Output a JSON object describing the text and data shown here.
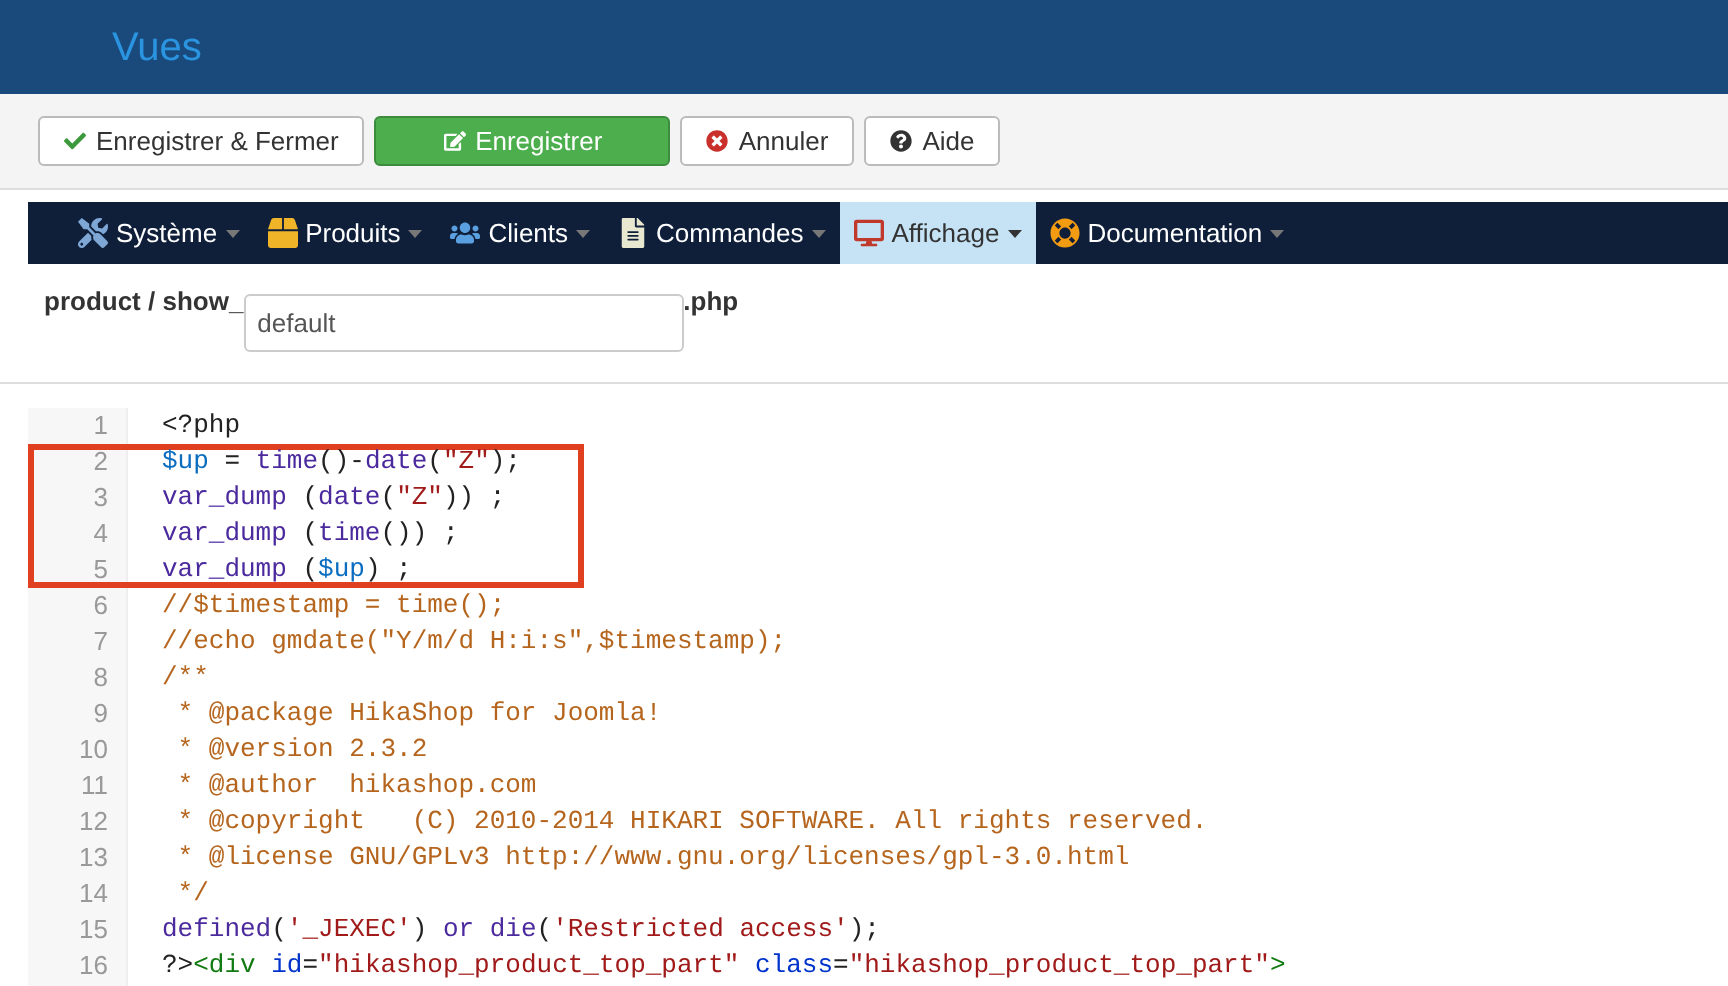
{
  "header": {
    "title": "Vues"
  },
  "toolbar": [
    {
      "label": "Enregistrer & Fermer",
      "kind": "check",
      "primary": false
    },
    {
      "label": "Enregistrer",
      "kind": "edit",
      "primary": true
    },
    {
      "label": "Annuler",
      "kind": "cancel",
      "primary": false
    },
    {
      "label": "Aide",
      "kind": "help",
      "primary": false
    }
  ],
  "menu": [
    {
      "label": "Système",
      "kind": "tools",
      "selected": false
    },
    {
      "label": "Produits",
      "kind": "box",
      "selected": false
    },
    {
      "label": "Clients",
      "kind": "users",
      "selected": false
    },
    {
      "label": "Commandes",
      "kind": "doc",
      "selected": false
    },
    {
      "label": "Affichage",
      "kind": "display",
      "selected": true
    },
    {
      "label": "Documentation",
      "kind": "help",
      "selected": false
    }
  ],
  "file": {
    "prefix": "product / show_",
    "value": "default",
    "suffix": ".php"
  },
  "code": [
    {
      "number": "1",
      "highlighted": false,
      "tokens": [
        {
          "text": "<?php",
          "kind": "plain"
        }
      ]
    },
    {
      "number": "2",
      "highlighted": true,
      "tokens": [
        {
          "text": "$up",
          "kind": "var"
        },
        {
          "text": " = ",
          "kind": "plain"
        },
        {
          "text": "time",
          "kind": "fn"
        },
        {
          "text": "()-",
          "kind": "plain"
        },
        {
          "text": "date",
          "kind": "fn"
        },
        {
          "text": "(",
          "kind": "plain"
        },
        {
          "text": "\"Z\"",
          "kind": "string"
        },
        {
          "text": ");",
          "kind": "plain"
        }
      ]
    },
    {
      "number": "3",
      "highlighted": true,
      "tokens": [
        {
          "text": "var_dump",
          "kind": "fn"
        },
        {
          "text": " (",
          "kind": "plain"
        },
        {
          "text": "date",
          "kind": "fn"
        },
        {
          "text": "(",
          "kind": "plain"
        },
        {
          "text": "\"Z\"",
          "kind": "string"
        },
        {
          "text": ")) ;",
          "kind": "plain"
        }
      ]
    },
    {
      "number": "4",
      "highlighted": true,
      "tokens": [
        {
          "text": "var_dump",
          "kind": "fn"
        },
        {
          "text": " (",
          "kind": "plain"
        },
        {
          "text": "time",
          "kind": "fn"
        },
        {
          "text": "()) ;",
          "kind": "plain"
        }
      ]
    },
    {
      "number": "5",
      "highlighted": true,
      "tokens": [
        {
          "text": "var_dump",
          "kind": "fn"
        },
        {
          "text": " (",
          "kind": "plain"
        },
        {
          "text": "$up",
          "kind": "var"
        },
        {
          "text": ") ;",
          "kind": "plain"
        }
      ]
    },
    {
      "number": "6",
      "highlighted": false,
      "tokens": [
        {
          "text": "//$timestamp = time();",
          "kind": "comment"
        }
      ]
    },
    {
      "number": "7",
      "highlighted": false,
      "tokens": [
        {
          "text": "//echo gmdate(\"Y/m/d H:i:s\",$timestamp);",
          "kind": "comment"
        }
      ]
    },
    {
      "number": "8",
      "highlighted": false,
      "tokens": [
        {
          "text": "/**",
          "kind": "comment"
        }
      ]
    },
    {
      "number": "9",
      "highlighted": false,
      "tokens": [
        {
          "text": " * @package HikaShop for Joomla!",
          "kind": "comment"
        }
      ]
    },
    {
      "number": "10",
      "highlighted": false,
      "tokens": [
        {
          "text": " * @version 2.3.2",
          "kind": "comment"
        }
      ]
    },
    {
      "number": "11",
      "highlighted": false,
      "tokens": [
        {
          "text": " * @author  hikashop.com",
          "kind": "comment"
        }
      ]
    },
    {
      "number": "12",
      "highlighted": false,
      "tokens": [
        {
          "text": " * @copyright   (C) 2010-2014 HIKARI SOFTWARE. All rights reserved.",
          "kind": "comment"
        }
      ]
    },
    {
      "number": "13",
      "highlighted": false,
      "tokens": [
        {
          "text": " * @license GNU/GPLv3 http://www.gnu.org/licenses/gpl-3.0.html",
          "kind": "comment"
        }
      ]
    },
    {
      "number": "14",
      "highlighted": false,
      "tokens": [
        {
          "text": " */",
          "kind": "comment"
        }
      ]
    },
    {
      "number": "15",
      "highlighted": false,
      "tokens": [
        {
          "text": "defined",
          "kind": "fn"
        },
        {
          "text": "(",
          "kind": "plain"
        },
        {
          "text": "'_JEXEC'",
          "kind": "string"
        },
        {
          "text": ") ",
          "kind": "plain"
        },
        {
          "text": "or die",
          "kind": "fn"
        },
        {
          "text": "(",
          "kind": "plain"
        },
        {
          "text": "'Restricted access'",
          "kind": "string"
        },
        {
          "text": ");",
          "kind": "plain"
        }
      ]
    },
    {
      "number": "16",
      "highlighted": false,
      "tokens": [
        {
          "text": "?>",
          "kind": "plain"
        },
        {
          "text": "<div",
          "kind": "tag"
        },
        {
          "text": " id",
          "kind": "attr"
        },
        {
          "text": "=",
          "kind": "plain"
        },
        {
          "text": "\"hikashop_product_top_part\"",
          "kind": "string"
        },
        {
          "text": " class",
          "kind": "attr"
        },
        {
          "text": "=",
          "kind": "plain"
        },
        {
          "text": "\"hikashop_product_top_part\"",
          "kind": "string"
        },
        {
          "text": ">",
          "kind": "tag"
        }
      ]
    }
  ]
}
